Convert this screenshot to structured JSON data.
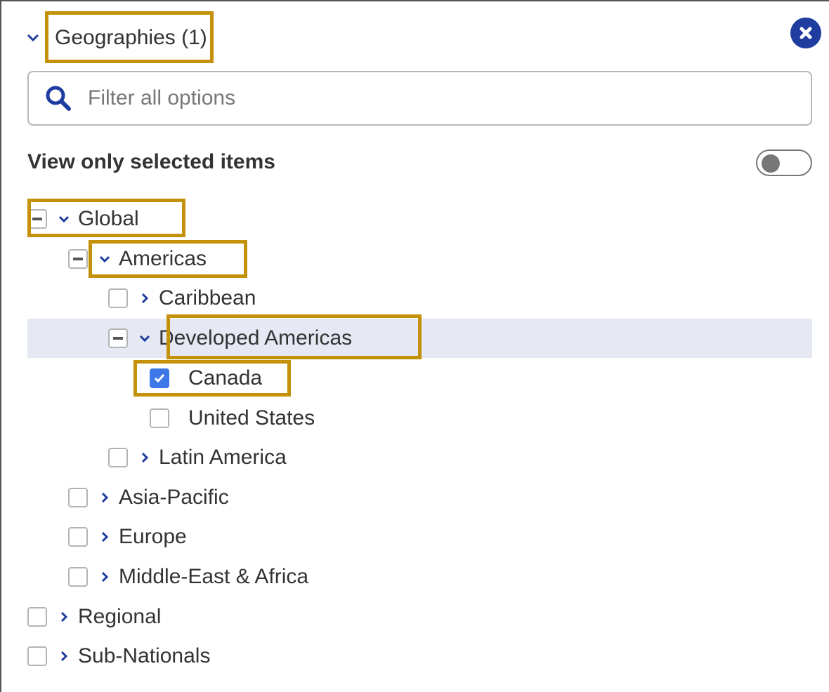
{
  "header": {
    "title": "Geographies (1)"
  },
  "search": {
    "placeholder": "Filter all options"
  },
  "view_only": {
    "label": "View only selected items",
    "enabled": false
  },
  "tree": [
    {
      "label": "Global",
      "state": "partial",
      "expanded": true
    },
    {
      "label": "Americas",
      "state": "partial",
      "expanded": true
    },
    {
      "label": "Caribbean",
      "state": "unchecked",
      "expanded": false
    },
    {
      "label": "Developed Americas",
      "state": "partial",
      "expanded": true
    },
    {
      "label": "Canada",
      "state": "checked"
    },
    {
      "label": "United States",
      "state": "unchecked"
    },
    {
      "label": "Latin America",
      "state": "unchecked",
      "expanded": false
    },
    {
      "label": "Asia-Pacific",
      "state": "unchecked",
      "expanded": false
    },
    {
      "label": "Europe",
      "state": "unchecked",
      "expanded": false
    },
    {
      "label": "Middle-East & Africa",
      "state": "unchecked",
      "expanded": false
    },
    {
      "label": "Regional",
      "state": "unchecked",
      "expanded": false
    },
    {
      "label": "Sub-Nationals",
      "state": "unchecked",
      "expanded": false
    }
  ],
  "colors": {
    "accent": "#1f3c9f",
    "checkbox_checked": "#3d77e8",
    "highlight_row": "#e6e9f4",
    "annotation_box": "#c4910b"
  },
  "icons": [
    "chevron-down-icon",
    "close-icon",
    "search-icon",
    "chevron-right-icon",
    "checkmark-icon"
  ]
}
